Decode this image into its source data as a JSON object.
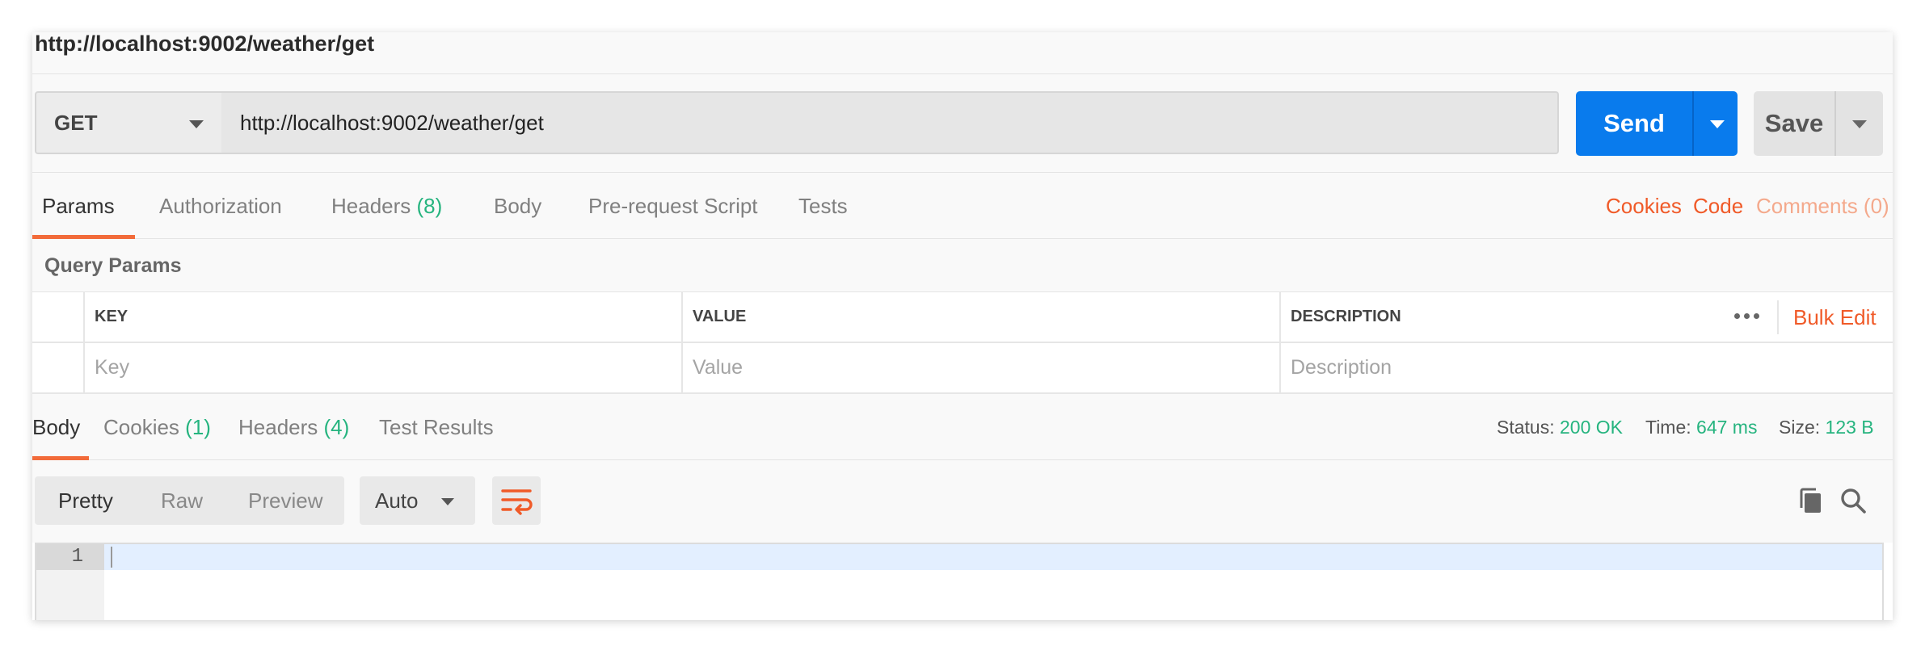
{
  "request": {
    "title": "http://localhost:9002/weather/get",
    "method": "GET",
    "url": "http://localhost:9002/weather/get",
    "send_label": "Send",
    "save_label": "Save"
  },
  "request_tabs": {
    "params": "Params",
    "authorization": "Authorization",
    "headers": "Headers",
    "headers_count": "(8)",
    "body": "Body",
    "prerequest": "Pre-request Script",
    "tests": "Tests"
  },
  "request_links": {
    "cookies": "Cookies",
    "code": "Code",
    "comments": "Comments (0)"
  },
  "query_params": {
    "heading": "Query Params",
    "columns": [
      "KEY",
      "VALUE",
      "DESCRIPTION"
    ],
    "placeholders": [
      "Key",
      "Value",
      "Description"
    ],
    "bulk_edit": "Bulk Edit"
  },
  "response_tabs": {
    "body": "Body",
    "cookies": "Cookies",
    "cookies_count": "(1)",
    "headers": "Headers",
    "headers_count": "(4)",
    "test_results": "Test Results"
  },
  "response_status": {
    "status_label": "Status:",
    "status_value": "200 OK",
    "time_label": "Time:",
    "time_value": "647 ms",
    "size_label": "Size:",
    "size_value": "123 B"
  },
  "body_toolbar": {
    "pretty": "Pretty",
    "raw": "Raw",
    "preview": "Preview",
    "format": "Auto"
  },
  "editor": {
    "line_number": "1"
  },
  "colors": {
    "send_blue": "#097bed",
    "accent_orange": "#f26b3a",
    "status_green": "#26b47f"
  }
}
